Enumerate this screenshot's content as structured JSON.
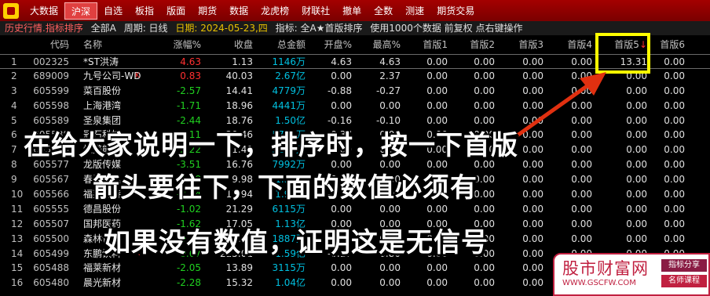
{
  "menu": [
    {
      "label": "大数据",
      "active": false
    },
    {
      "label": "沪深",
      "active": true
    },
    {
      "label": "自选",
      "active": false
    },
    {
      "label": "板指",
      "active": false
    },
    {
      "label": "版面",
      "active": false
    },
    {
      "label": "期货",
      "active": false
    },
    {
      "label": "数据",
      "active": false
    },
    {
      "label": "龙虎榜",
      "active": false
    },
    {
      "label": "财联社",
      "active": false
    },
    {
      "label": "撤单",
      "active": false
    },
    {
      "label": "全数",
      "active": false
    },
    {
      "label": "测速",
      "active": false
    },
    {
      "label": "期货交易",
      "active": false
    }
  ],
  "status": {
    "title": "历史行情.指标排序",
    "market": "全部A",
    "period": "周期: 日线",
    "date": "日期: 2024-05-23,四",
    "indicator": "指标: 全A★首版排序",
    "note": "使用1000个数据 前复权 点右键操作"
  },
  "table": {
    "headers": {
      "code": "代码",
      "name": "名称",
      "chg": "涨幅%",
      "close": "收盘",
      "amount": "总金额",
      "open": "开盘%",
      "high": "最高%",
      "b1": "首版1",
      "b2": "首版2",
      "b3": "首版3",
      "b4": "首版4",
      "b5": "首版5",
      "b5_arrow": "↓",
      "b6": "首版6"
    },
    "rows": [
      {
        "idx": "1",
        "code": "002325",
        "name": "*ST洪涛",
        "flag": "",
        "chg": "4.63",
        "close": "1.13",
        "amount": "1146",
        "unit": "万",
        "open": "4.63",
        "high": "4.63",
        "b1": "0.00",
        "b2": "0.00",
        "b3": "0.00",
        "b4": "0.00",
        "b5": "13.31",
        "b6": "0.00"
      },
      {
        "idx": "2",
        "code": "689009",
        "name": "九号公司-WD",
        "flag": "K",
        "chg": "0.83",
        "close": "40.03",
        "amount": "2.67",
        "unit": "亿",
        "open": "0.00",
        "high": "2.37",
        "b1": "0.00",
        "b2": "0.00",
        "b3": "0.00",
        "b4": "0.00",
        "b5": "0.00",
        "b6": "0.00"
      },
      {
        "idx": "3",
        "code": "605599",
        "name": "菜百股份",
        "flag": "",
        "chg": "-2.57",
        "close": "14.41",
        "amount": "4779",
        "unit": "万",
        "open": "-0.88",
        "high": "-0.27",
        "b1": "0.00",
        "b2": "0.00",
        "b3": "0.00",
        "b4": "0.00",
        "b5": "0.00",
        "b6": "0.00"
      },
      {
        "idx": "4",
        "code": "605598",
        "name": "上海港湾",
        "flag": "",
        "chg": "-1.71",
        "close": "18.96",
        "amount": "4441",
        "unit": "万",
        "open": "0.00",
        "high": "0.00",
        "b1": "0.00",
        "b2": "0.00",
        "b3": "0.00",
        "b4": "0.00",
        "b5": "0.00",
        "b6": "0.00"
      },
      {
        "idx": "5",
        "code": "605589",
        "name": "圣泉集团",
        "flag": "",
        "chg": "-2.44",
        "close": "18.76",
        "amount": "1.50",
        "unit": "亿",
        "open": "-0.16",
        "high": "-0.10",
        "b1": "0.00",
        "b2": "0.00",
        "b3": "0.00",
        "b4": "0.00",
        "b5": "0.00",
        "b6": "0.00"
      },
      {
        "idx": "6",
        "code": "605588",
        "name": "冠石科技",
        "flag": "",
        "chg": "-1.11",
        "close": "29.46",
        "amount": "5701",
        "unit": "万",
        "open": "-0.37",
        "high": "0.00",
        "b1": "0.00",
        "b2": "0.00",
        "b3": "0.00",
        "b4": "0.00",
        "b5": "0.00",
        "b6": "0.00"
      },
      {
        "idx": "7",
        "code": "605580",
        "name": "恒盛能源",
        "flag": "",
        "chg": "-2.22",
        "close": "11.42",
        "amount": "5256",
        "unit": "万",
        "open": "0.00",
        "high": "0.00",
        "b1": "0.00",
        "b2": "0.00",
        "b3": "0.00",
        "b4": "0.00",
        "b5": "0.00",
        "b6": "0.00"
      },
      {
        "idx": "8",
        "code": "605577",
        "name": "龙版传媒",
        "flag": "",
        "chg": "-3.51",
        "close": "16.76",
        "amount": "7992",
        "unit": "万",
        "open": "0.00",
        "high": "0.00",
        "b1": "0.00",
        "b2": "0.00",
        "b3": "0.00",
        "b4": "0.00",
        "b5": "0.00",
        "b6": "0.00"
      },
      {
        "idx": "9",
        "code": "605567",
        "name": "春雪食品",
        "flag": "",
        "chg": "-1.48",
        "close": "9.98",
        "amount": "1.35",
        "unit": "亿",
        "open": "0.00",
        "high": "0.00",
        "b1": "0.00",
        "b2": "0.00",
        "b3": "0.00",
        "b4": "0.00",
        "b5": "0.00",
        "b6": "0.00"
      },
      {
        "idx": "10",
        "code": "605566",
        "name": "福莱蒽特",
        "flag": "",
        "chg": "-2.04",
        "close": "17.94",
        "amount": "1.95",
        "unit": "亿",
        "open": "-0.33",
        "high": "0.00",
        "b1": "0.00",
        "b2": "0.00",
        "b3": "0.00",
        "b4": "0.00",
        "b5": "0.00",
        "b6": "0.00"
      },
      {
        "idx": "11",
        "code": "605555",
        "name": "德昌股份",
        "flag": "",
        "chg": "-1.02",
        "close": "21.29",
        "amount": "6115",
        "unit": "万",
        "open": "0.00",
        "high": "0.00",
        "b1": "0.00",
        "b2": "0.00",
        "b3": "0.00",
        "b4": "0.00",
        "b5": "0.00",
        "b6": "0.00"
      },
      {
        "idx": "12",
        "code": "605507",
        "name": "国邦医药",
        "flag": "",
        "chg": "-1.62",
        "close": "17.05",
        "amount": "1.13",
        "unit": "亿",
        "open": "0.00",
        "high": "0.00",
        "b1": "0.00",
        "b2": "0.00",
        "b3": "0.00",
        "b4": "0.00",
        "b5": "0.00",
        "b6": "0.00"
      },
      {
        "idx": "13",
        "code": "605500",
        "name": "森林包装",
        "flag": "",
        "chg": "-0.79",
        "close": "12.58",
        "amount": "1887",
        "unit": "万",
        "open": "0.00",
        "high": "0.00",
        "b1": "0.00",
        "b2": "0.00",
        "b3": "0.00",
        "b4": "0.00",
        "b5": "0.00",
        "b6": "0.00"
      },
      {
        "idx": "14",
        "code": "605499",
        "name": "东鹏饮料",
        "flag": "R",
        "chg": "-0.67",
        "close": "225.01",
        "amount": "1.59",
        "unit": "亿",
        "open": "-0.17",
        "high": "0.80",
        "b1": "0.00",
        "b2": "0.00",
        "b3": "0.00",
        "b4": "0.00",
        "b5": "0.00",
        "b6": "0.00"
      },
      {
        "idx": "15",
        "code": "605488",
        "name": "福莱新材",
        "flag": "",
        "chg": "-2.05",
        "close": "13.89",
        "amount": "3115",
        "unit": "万",
        "open": "0.00",
        "high": "0.00",
        "b1": "0.00",
        "b2": "0.00",
        "b3": "0.00",
        "b4": "0.00",
        "b5": "0.00",
        "b6": "0.00"
      },
      {
        "idx": "16",
        "code": "605480",
        "name": "晨光新材",
        "flag": "",
        "chg": "-2.28",
        "close": "15.32",
        "amount": "1.04",
        "unit": "亿",
        "open": "0.00",
        "high": "0.00",
        "b1": "0.00",
        "b2": "0.00",
        "b3": "0.00",
        "b4": "0.00",
        "b5": "0.00",
        "b6": "0.00"
      }
    ]
  },
  "overlay": {
    "line1": "在给大家说明一下，排序时，按一下首版",
    "line2": "箭头要往下，下面的数值必须有",
    "line3": "如果没有数值，证明这是无信号"
  },
  "watermark": {
    "title": "股市财富网",
    "url": "WWW.GSCFW.COM",
    "tag1": "指标分享",
    "tag2": "名师课程"
  },
  "colors": {
    "up": "#ff3030",
    "down": "#20d020",
    "amount": "#00c0e0",
    "highlight": "#ffff00",
    "arrow": "#e03010"
  }
}
